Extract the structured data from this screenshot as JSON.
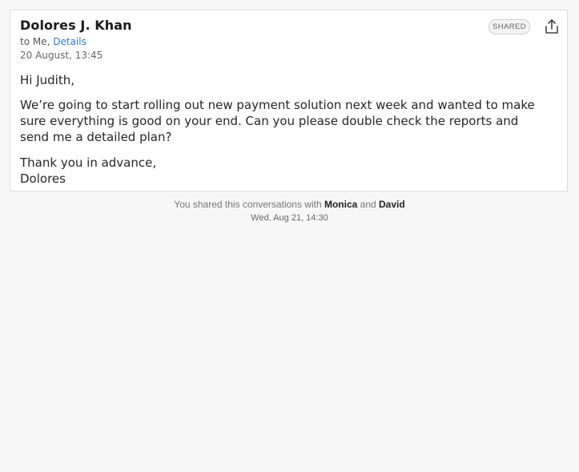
{
  "email": {
    "sender_name": "Dolores J. Khan",
    "recipients_prefix": "to Me, ",
    "details_link": "Details",
    "date": "20 August, 13:45",
    "badge": "SHARED",
    "share_icon": "share-upload-icon",
    "greeting": "Hi Judith,",
    "message_lines": [
      "We’re going to start rolling out new payment solution next week and wanted to make",
      "sure everything is good on your end. Can you please double check the reports and",
      "send me a detailed plan?"
    ],
    "closing_lines": [
      "Thank you in advance,",
      "Dolores"
    ]
  },
  "share_notice": {
    "prefix": "You shared this conversations with ",
    "person_1": "Monica",
    "conjunction": " and ",
    "person_2": "David",
    "timestamp": "Wed, Aug 21, 14:30"
  },
  "colors": {
    "link": "#2a7bd4",
    "background": "#f7f7f7",
    "card": "#ffffff"
  }
}
